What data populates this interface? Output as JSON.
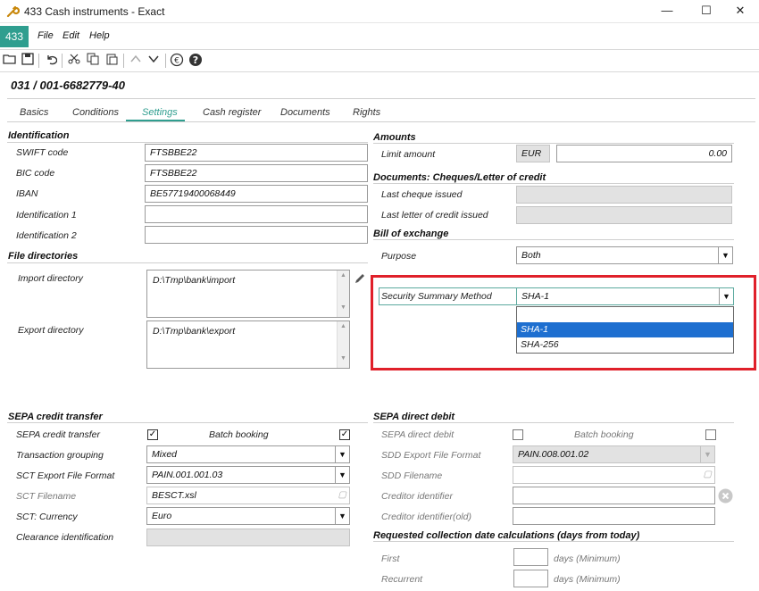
{
  "window": {
    "title": "433 Cash instruments - Exact",
    "min": "—",
    "max": "☐",
    "close": "✕"
  },
  "menu": {
    "app_number": "433",
    "items": [
      "File",
      "Edit",
      "Help"
    ]
  },
  "record_title": "031 / 001-6682779-40",
  "tabs": [
    {
      "label": "Basics"
    },
    {
      "label": "Conditions"
    },
    {
      "label": "Settings",
      "active": true
    },
    {
      "label": "Cash register"
    },
    {
      "label": "Documents"
    },
    {
      "label": "Rights"
    }
  ],
  "identification": {
    "heading": "Identification",
    "swift_label": "SWIFT code",
    "swift_value": "FTSBBE22",
    "bic_label": "BIC code",
    "bic_value": "FTSBBE22",
    "iban_label": "IBAN",
    "iban_value": "BE57719400068449",
    "id1_label": "Identification 1",
    "id1_value": "",
    "id2_label": "Identification 2",
    "id2_value": ""
  },
  "file_directories": {
    "heading": "File directories",
    "import_label": "Import directory",
    "import_value": "D:\\Tmp\\bank\\import",
    "export_label": "Export directory",
    "export_value": "D:\\Tmp\\bank\\export"
  },
  "amounts": {
    "heading": "Amounts",
    "limit_label": "Limit amount",
    "currency": "EUR",
    "limit_value": "0.00"
  },
  "documents": {
    "heading": "Documents: Cheques/Letter of credit",
    "last_cheque_label": "Last cheque issued",
    "last_cheque_value": "",
    "last_letter_label": "Last letter of credit issued",
    "last_letter_value": ""
  },
  "bill_of_exchange": {
    "heading": "Bill of exchange",
    "purpose_label": "Purpose",
    "purpose_value": "Both"
  },
  "security": {
    "label": "Security Summary Method",
    "value": "SHA-1",
    "options": [
      "",
      "SHA-1",
      "SHA-256"
    ],
    "selected_index": 1
  },
  "sepa_credit": {
    "heading": "SEPA credit transfer",
    "transfer_label": "SEPA credit transfer",
    "transfer_checked": "✓",
    "batch_label": "Batch booking",
    "batch_checked": "✓",
    "grouping_label": "Transaction grouping",
    "grouping_value": "Mixed",
    "format_label": "SCT Export File Format",
    "format_value": "PAIN.001.001.03",
    "filename_label": "SCT Filename",
    "filename_value": "BESCT.xsl",
    "currency_label": "SCT: Currency",
    "currency_value": "Euro",
    "clearance_label": "Clearance identification",
    "clearance_value": ""
  },
  "sepa_debit": {
    "heading": "SEPA direct debit",
    "debit_label": "SEPA direct debit",
    "batch_label": "Batch booking",
    "format_label": "SDD Export File Format",
    "format_value": "PAIN.008.001.02",
    "filename_label": "SDD Filename",
    "filename_value": "",
    "creditor_label": "Creditor identifier",
    "creditor_value": "",
    "creditor_old_label": "Creditor identifier(old)",
    "creditor_old_value": ""
  },
  "collection": {
    "heading": "Requested collection date calculations (days from today)",
    "first_label": "First",
    "first_value": "",
    "first_unit": "days (Minimum)",
    "recurrent_label": "Recurrent",
    "recurrent_value": "",
    "recurrent_unit": "days (Minimum)"
  },
  "colors": {
    "accent": "#2f9e8f",
    "highlight_border": "#e0202a",
    "selection": "#1e6fd0"
  }
}
